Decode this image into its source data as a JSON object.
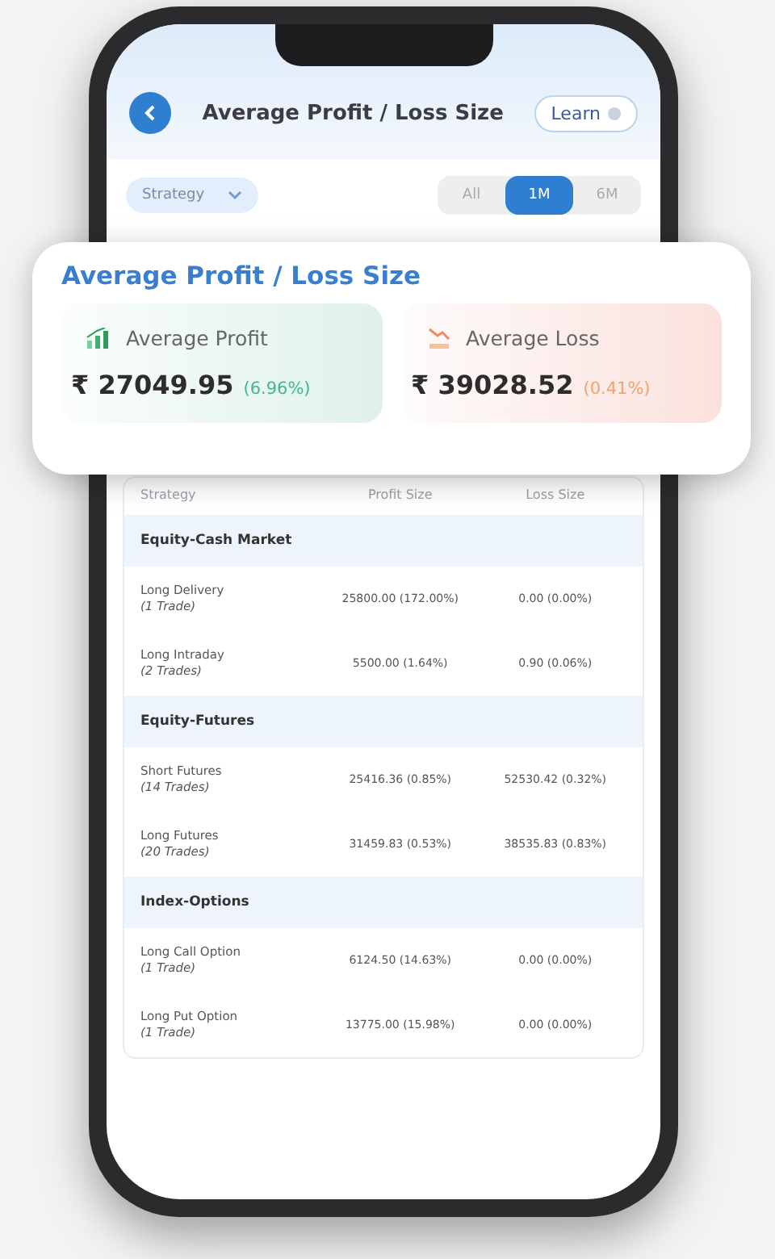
{
  "header": {
    "title": "Average Profit / Loss Size",
    "learn_button": "Learn"
  },
  "filters": {
    "strategy_dropdown": "Strategy",
    "periods": [
      {
        "label": "All",
        "selected": false
      },
      {
        "label": "1M",
        "selected": true
      },
      {
        "label": "6M",
        "selected": false
      }
    ]
  },
  "summary_card": {
    "title": "Average Profit / Loss Size",
    "tiles": [
      {
        "kind": "profit",
        "label": "Average Profit",
        "value": "₹ 27049.95",
        "change": "(6.96%)"
      },
      {
        "kind": "loss",
        "label": "Average Loss",
        "value": "₹ 39028.52",
        "change": "(0.41%)"
      }
    ]
  },
  "table": {
    "columns": [
      "Strategy",
      "Profit Size",
      "Loss Size"
    ],
    "groups": [
      {
        "name": "Equity-Cash Market",
        "rows": [
          {
            "strategy": "Long Delivery",
            "trades": "(1 Trade)",
            "profit": "25800.00 (172.00%)",
            "loss": "0.00 (0.00%)"
          },
          {
            "strategy": "Long Intraday",
            "trades": "(2 Trades)",
            "profit": "5500.00 (1.64%)",
            "loss": "0.90 (0.06%)"
          }
        ]
      },
      {
        "name": "Equity-Futures",
        "rows": [
          {
            "strategy": "Short Futures",
            "trades": "(14 Trades)",
            "profit": "25416.36 (0.85%)",
            "loss": "52530.42 (0.32%)"
          },
          {
            "strategy": "Long Futures",
            "trades": "(20 Trades)",
            "profit": "31459.83 (0.53%)",
            "loss": "38535.83 (0.83%)"
          }
        ]
      },
      {
        "name": "Index-Options",
        "rows": [
          {
            "strategy": "Long Call Option",
            "trades": "(1 Trade)",
            "profit": "6124.50 (14.63%)",
            "loss": "0.00 (0.00%)"
          },
          {
            "strategy": "Long Put Option",
            "trades": "(1 Trade)",
            "profit": "13775.00 (15.98%)",
            "loss": "0.00 (0.00%)"
          }
        ]
      }
    ]
  }
}
